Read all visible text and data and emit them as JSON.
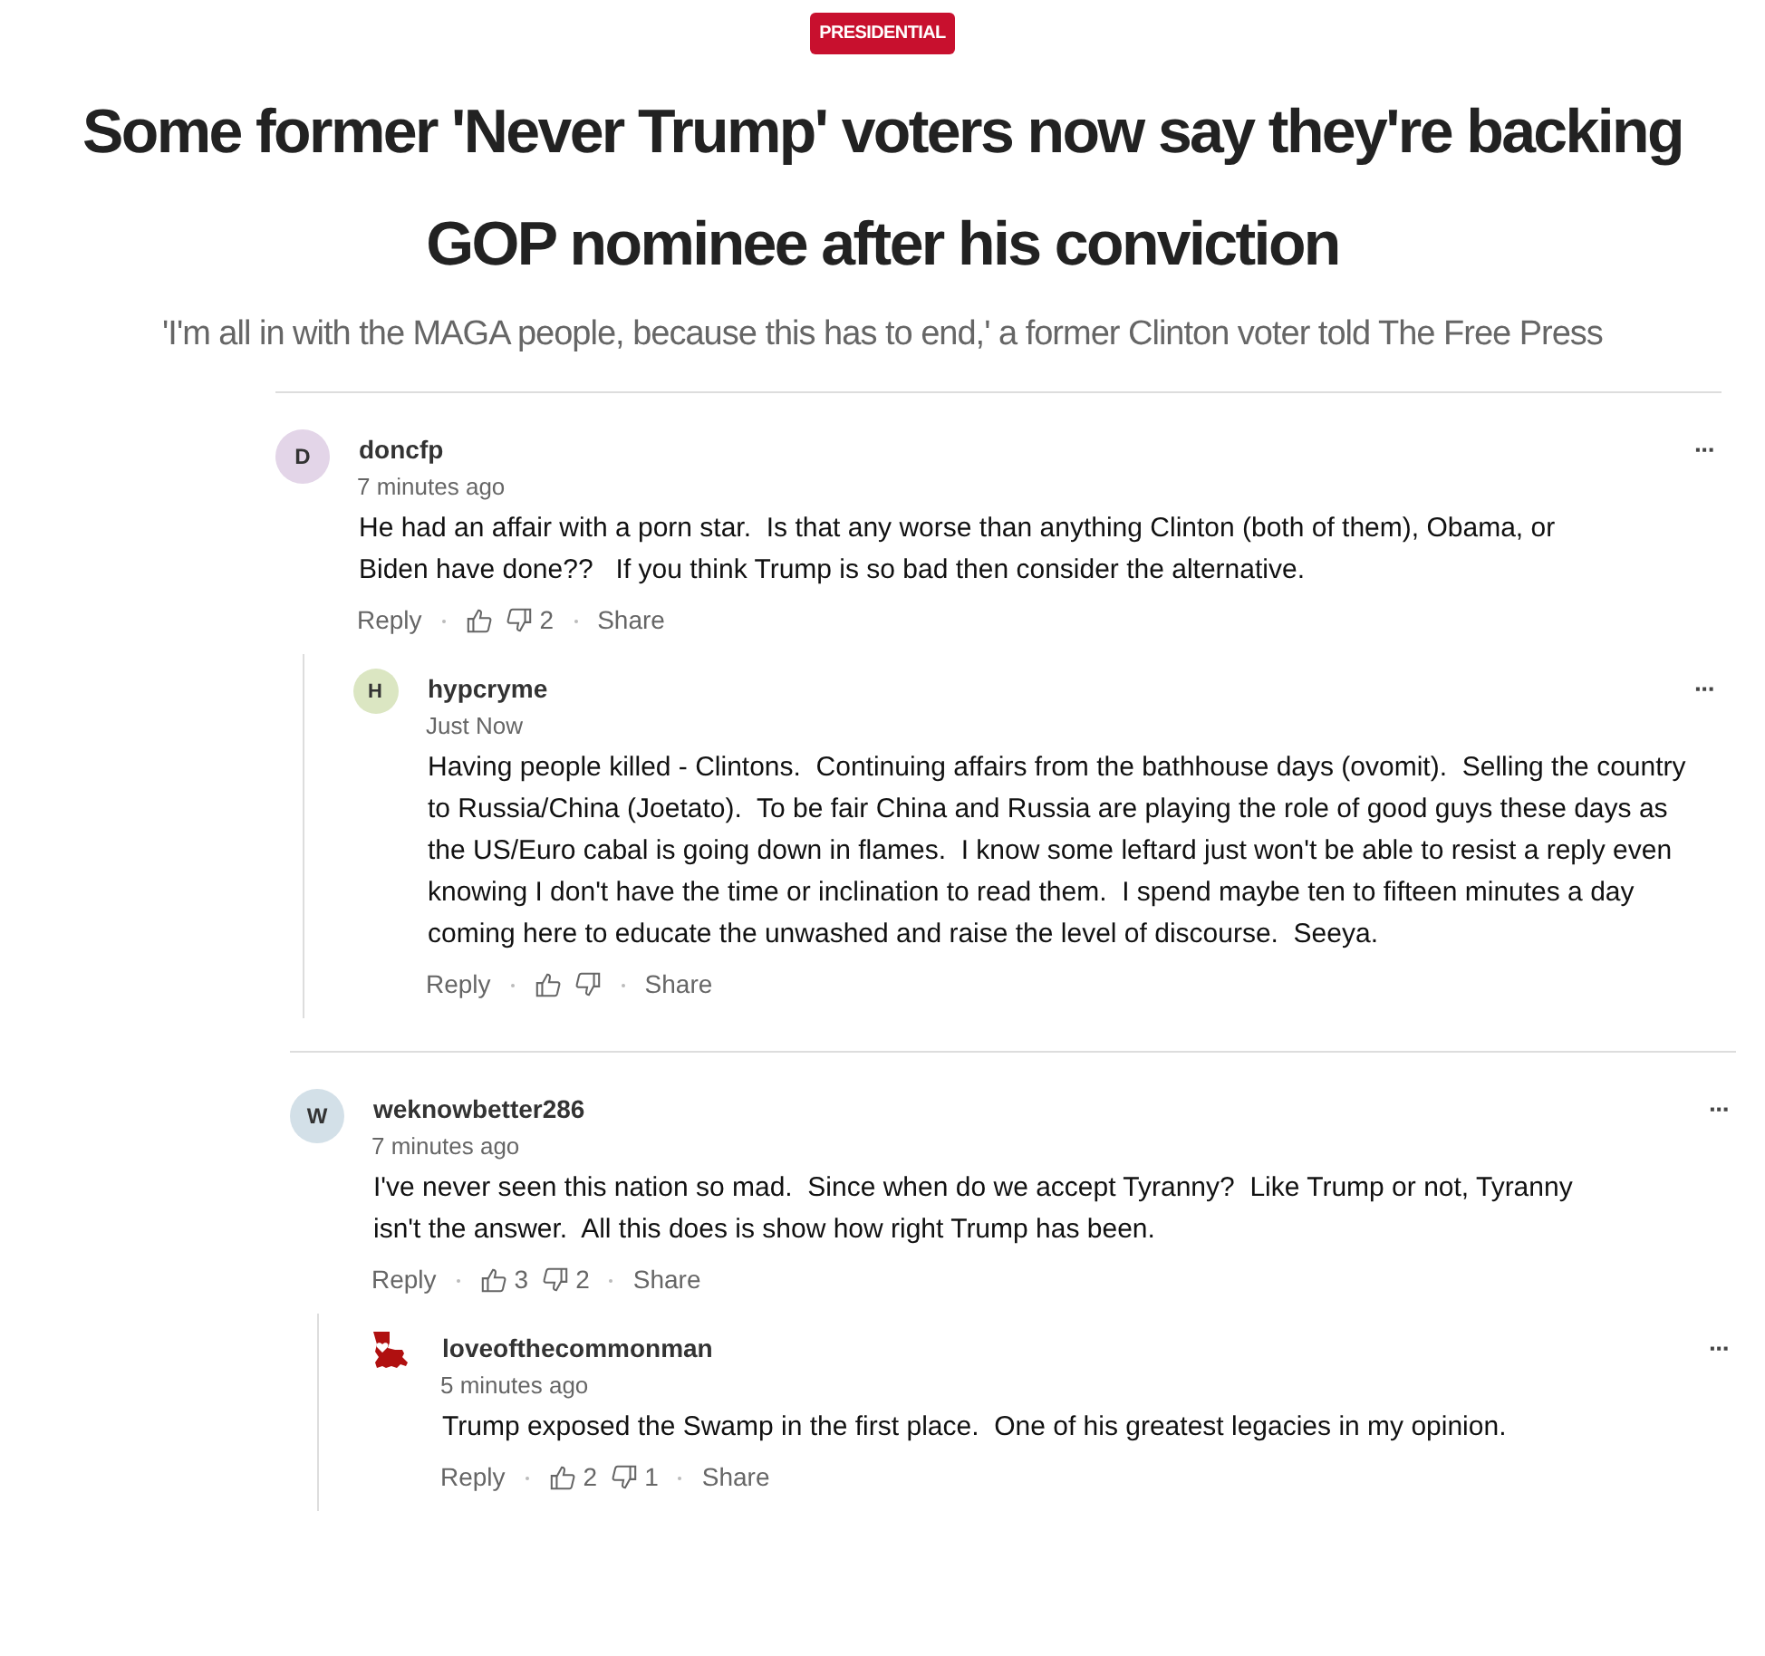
{
  "category": "PRESIDENTIAL",
  "headline": "Some former 'Never Trump' voters now say they're backing GOP nominee after his conviction",
  "subheadline": "'I'm all in with the MAGA people, because this has to end,' a former Clinton voter told The Free Press",
  "threads": [
    {
      "author": "doncfp",
      "avatar": {
        "kind": "letter",
        "letter": "D",
        "color": "#e3d5e8"
      },
      "time": "7 minutes ago",
      "menu": "···",
      "text": "He had an affair with a porn star.  Is that any worse than anything Clinton (both of them), Obama, or Biden have done??   If you think Trump is so bad then consider the alternative.",
      "reply": "Reply",
      "dislikes": "2",
      "share": "Share",
      "children": [
        {
          "author": "hypcryme",
          "avatar": {
            "kind": "letter",
            "letter": "H",
            "color": "#dbe6c2"
          },
          "time": "Just Now",
          "menu": "···",
          "text": "Having people killed - Clintons.  Continuing affairs from the bathhouse days (ovomit).  Selling the country to Russia/China (Joetato).  To be fair China and Russia are playing the role of good guys these days as the US/Euro cabal is going down in flames.  I know some leftard just won't be able to resist a reply even knowing I don't have the time or inclination to read them.  I spend maybe ten to fifteen minutes a day coming here to educate the unwashed and raise the level of discourse.  Seeya.",
          "reply": "Reply",
          "share": "Share"
        }
      ]
    },
    {
      "author": "weknowbetter286",
      "avatar": {
        "kind": "letter",
        "letter": "W",
        "color": "#d3e0e8"
      },
      "time": "7 minutes ago",
      "menu": "···",
      "text": "I've never seen this nation so mad.  Since when do we accept Tyranny?  Like Trump or not, Tyranny isn't the answer.  All this does is show how right Trump has been.",
      "reply": "Reply",
      "likes": "3",
      "dislikes": "2",
      "share": "Share",
      "children": [
        {
          "author": "loveofthecommonman",
          "avatar": {
            "kind": "image",
            "color": "#b01010"
          },
          "time": "5 minutes ago",
          "menu": "···",
          "text": "Trump exposed the Swamp in the first place.  One of his greatest legacies in my opinion.",
          "reply": "Reply",
          "likes": "2",
          "dislikes": "1",
          "share": "Share"
        }
      ]
    }
  ]
}
